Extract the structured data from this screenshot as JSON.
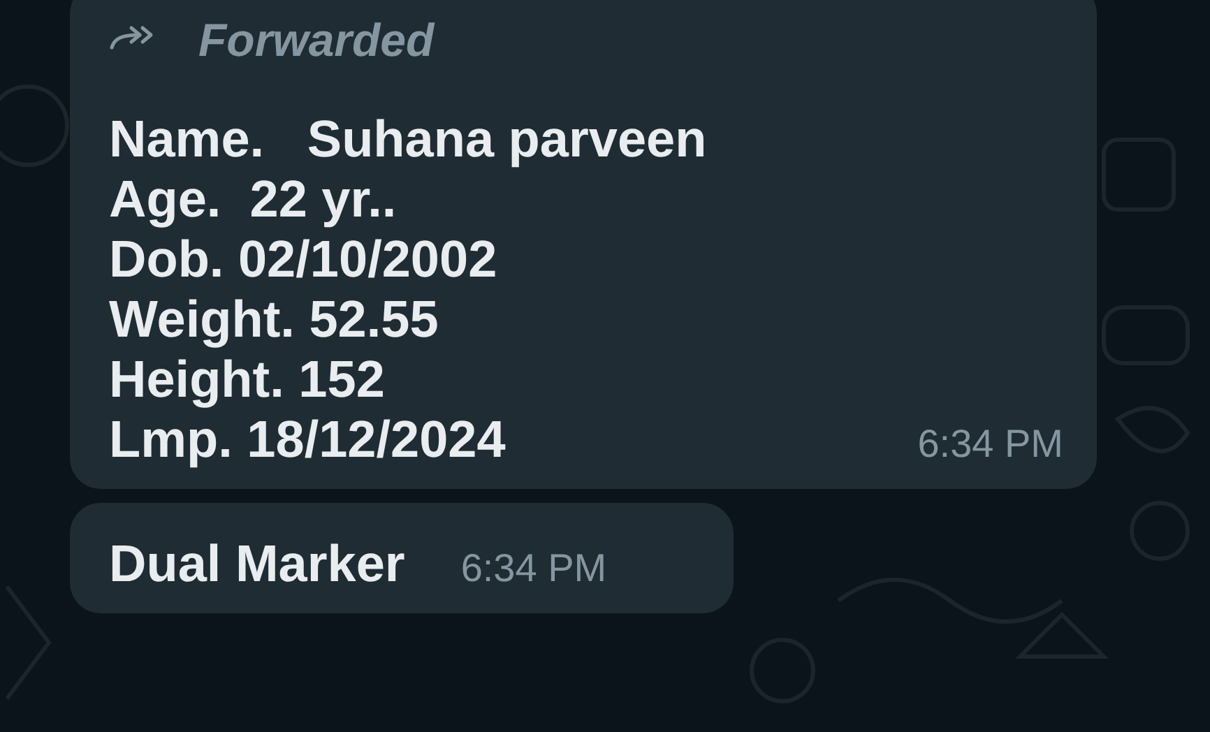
{
  "messages": [
    {
      "kind": "forwarded",
      "forward_label": "Forwarded",
      "lines": [
        "Name.   Suhana parveen",
        "Age.  22 yr..",
        "Dob. 02/10/2002",
        "Weight. 52.55",
        "Height. 152",
        "Lmp. 18/12/2024"
      ],
      "time": "6:34 PM"
    },
    {
      "kind": "plain",
      "lines": [
        "Dual Marker"
      ],
      "time": "6:34 PM"
    }
  ]
}
